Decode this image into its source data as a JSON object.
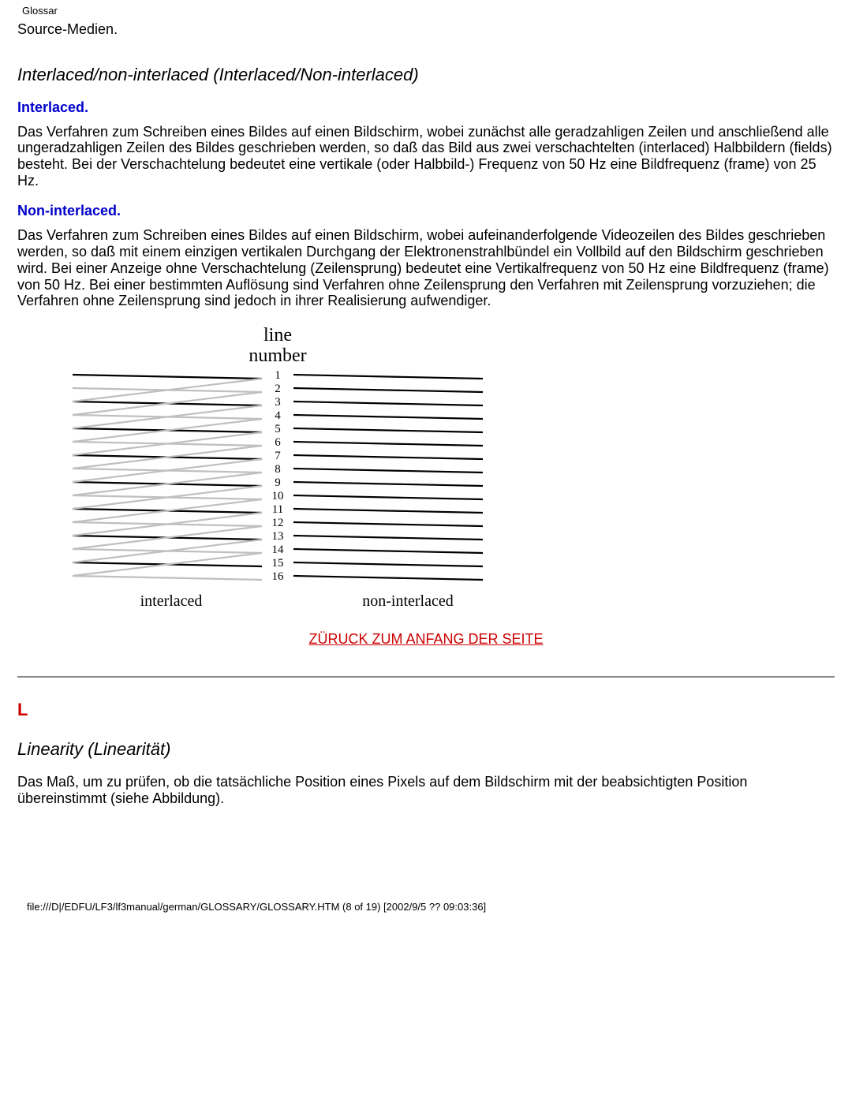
{
  "corner_label": "Glossar",
  "intro_fragment": "Source-Medien.",
  "entry1": {
    "title": "Interlaced/non-interlaced (Interlaced/Non-interlaced)",
    "sub1": "Interlaced.",
    "para1": "Das Verfahren zum Schreiben eines Bildes auf einen Bildschirm, wobei zunächst alle geradzahligen Zeilen und anschließend alle ungeradzahligen Zeilen des Bildes geschrieben werden, so daß das Bild aus zwei verschachtelten (interlaced) Halbbildern (fields) besteht. Bei der Verschachtelung bedeutet eine vertikale (oder Halbbild-) Frequenz von 50 Hz eine Bildfrequenz (frame) von 25 Hz.",
    "sub2": "Non-interlaced.",
    "para2": "Das Verfahren zum Schreiben eines Bildes auf einen Bildschirm, wobei aufeinanderfolgende Videozeilen des Bildes geschrieben werden, so daß mit einem einzigen vertikalen Durchgang der Elektronenstrahlbündel ein Vollbild auf den Bildschirm geschrieben wird. Bei einer Anzeige ohne Verschachtelung (Zeilensprung) bedeutet eine Vertikalfrequenz von 50 Hz eine Bildfrequenz (frame) von 50 Hz. Bei einer bestimmten Auflösung sind Verfahren ohne Zeilensprung den Verfahren mit Zeilensprung vorzuziehen; die Verfahren ohne Zeilensprung sind jedoch in ihrer Realisierung aufwendiger."
  },
  "figure": {
    "heading1": "line",
    "heading2": "number",
    "caption_left": "interlaced",
    "caption_right": "non-interlaced",
    "line_numbers": [
      "1",
      "2",
      "3",
      "4",
      "5",
      "6",
      "7",
      "8",
      "9",
      "10",
      "11",
      "12",
      "13",
      "14",
      "15",
      "16"
    ]
  },
  "back_to_top": "ZÜRUCK ZUM ANFANG DER SEITE",
  "section_letter": "L",
  "entry2": {
    "title": "Linearity (Linearität)",
    "para": "Das Maß, um zu prüfen, ob die tatsächliche Position eines Pixels auf dem Bildschirm mit der beabsichtigten Position übereinstimmt (siehe Abbildung)."
  },
  "footer": "file:///D|/EDFU/LF3/lf3manual/german/GLOSSARY/GLOSSARY.HTM (8 of 19) [2002/9/5 ?? 09:03:36]"
}
